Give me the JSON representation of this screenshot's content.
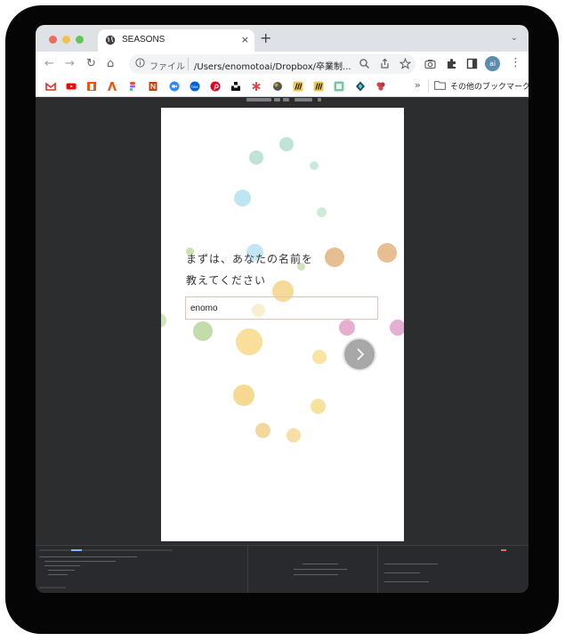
{
  "browser": {
    "tab": {
      "title": "SEASONS",
      "close": "×"
    },
    "new_tab": "+",
    "tab_menu": "⌄",
    "nav": {
      "back": "←",
      "forward": "→",
      "reload": "↻",
      "home": "⌂"
    },
    "omnibox": {
      "scheme_label": "ファイル",
      "url": "/Users/enomotoai/Dropbox/卒業制..."
    },
    "profile_initials": "ai",
    "menu": "⋮"
  },
  "bookmarks": {
    "more": "»",
    "other_label": "その他のブックマーク",
    "icons": [
      {
        "name": "gmail",
        "color": "#d93025"
      },
      {
        "name": "youtube",
        "color": "#ff0000"
      },
      {
        "name": "office",
        "color": "#e8590c"
      },
      {
        "name": "adobe",
        "color": "#e8590c"
      },
      {
        "name": "figma",
        "color": "#f24e1e"
      },
      {
        "name": "notion",
        "color": "#c2410c"
      },
      {
        "name": "zoom",
        "color": "#2d8cff"
      },
      {
        "name": "box",
        "color": "#0061d5"
      },
      {
        "name": "pinterest",
        "color": "#e60023"
      },
      {
        "name": "unsplash",
        "color": "#111111"
      },
      {
        "name": "asterisk",
        "color": "#e03e3e"
      },
      {
        "name": "sphere",
        "color": "#444444"
      },
      {
        "name": "miro",
        "color": "#f2c94c"
      },
      {
        "name": "miro-2",
        "color": "#f2c94c"
      },
      {
        "name": "canvas",
        "color": "#7cc4a4"
      },
      {
        "name": "gem",
        "color": "#184a5a"
      },
      {
        "name": "flower",
        "color": "#d64545"
      }
    ]
  },
  "app": {
    "prompt_line1": "まずは、あなたの名前を",
    "prompt_line2": "教えてください",
    "name_input": {
      "value": "enomo",
      "placeholder": ""
    },
    "next_icon": "chevron-right-icon"
  }
}
